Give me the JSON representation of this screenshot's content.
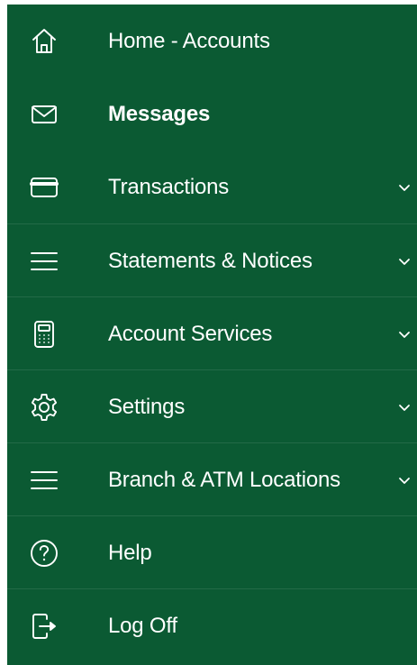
{
  "colors": {
    "menu_background": "#0b5a33",
    "text": "#ffffff"
  },
  "menu": {
    "items": [
      {
        "label": "Home - Accounts",
        "icon": "home-icon",
        "bold": false,
        "has_chevron": false
      },
      {
        "label": "Messages",
        "icon": "envelope-icon",
        "bold": true,
        "has_chevron": false
      },
      {
        "label": "Transactions",
        "icon": "card-icon",
        "bold": false,
        "has_chevron": true
      },
      {
        "label": "Statements & Notices",
        "icon": "hamburger-icon",
        "bold": false,
        "has_chevron": true
      },
      {
        "label": "Account Services",
        "icon": "calculator-icon",
        "bold": false,
        "has_chevron": true
      },
      {
        "label": "Settings",
        "icon": "gear-icon",
        "bold": false,
        "has_chevron": true
      },
      {
        "label": "Branch & ATM Locations",
        "icon": "hamburger-icon",
        "bold": false,
        "has_chevron": true
      },
      {
        "label": "Help",
        "icon": "help-icon",
        "bold": false,
        "has_chevron": false
      },
      {
        "label": "Log Off",
        "icon": "logout-icon",
        "bold": false,
        "has_chevron": false
      }
    ]
  }
}
